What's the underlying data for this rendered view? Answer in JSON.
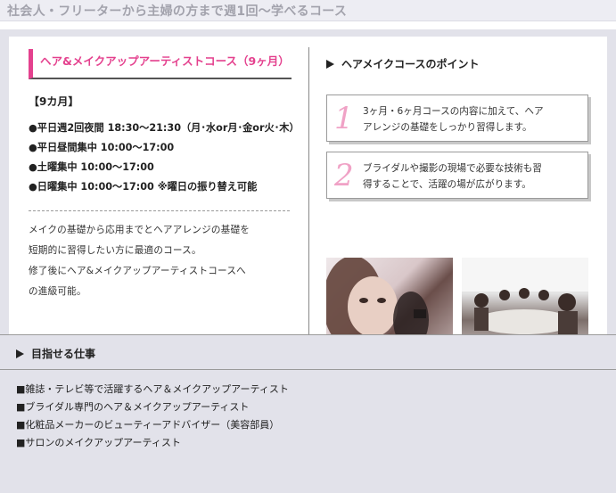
{
  "banner": {
    "text": "社会人・フリーターから主婦の方まで週1回〜学べるコース"
  },
  "course": {
    "title": "ヘア&メイクアップアーティストコース（9ヶ月）",
    "period": "【9カ月】",
    "schedule": [
      "●平日週2回夜間 18:30〜21:30（月･水or月･金or火･木）",
      "●平日昼間集中 10:00〜17:00",
      "●土曜集中 10:00〜17:00",
      "●日曜集中 10:00〜17:00 ※曜日の振り替え可能"
    ],
    "description": [
      "メイクの基礎から応用までとヘアアレンジの基礎を",
      "短期的に習得したい方に最適のコース。",
      "修了後にヘア&メイクアップアーティストコースへ",
      "の進級可能。"
    ]
  },
  "points": {
    "heading": "ヘアメイクコースのポイント",
    "items": [
      {
        "num": "1",
        "lines": [
          "3ヶ月・6ヶ月コースの内容に加えて、ヘア",
          "アレンジの基礎をしっかり習得します。"
        ]
      },
      {
        "num": "2",
        "lines": [
          "ブライダルや撮影の現場で必要な技術も習",
          "得することで、活躍の場が広がります。"
        ]
      }
    ]
  },
  "jobs": {
    "heading": "目指せる仕事",
    "items": [
      "■雑誌・テレビ等で活躍するヘア＆メイクアップアーティスト",
      "■ブライダル専門のヘア＆メイクアップアーティスト",
      "■化粧品メーカーのビューティーアドバイザー（美容部員）",
      "■サロンのメイクアップアーティスト"
    ]
  },
  "colors": {
    "accent": "#e4418e",
    "number": "#f0a2c6",
    "frame": "#e2e2ea"
  },
  "icons": {
    "heading_marker": "triangle-right-icon"
  }
}
